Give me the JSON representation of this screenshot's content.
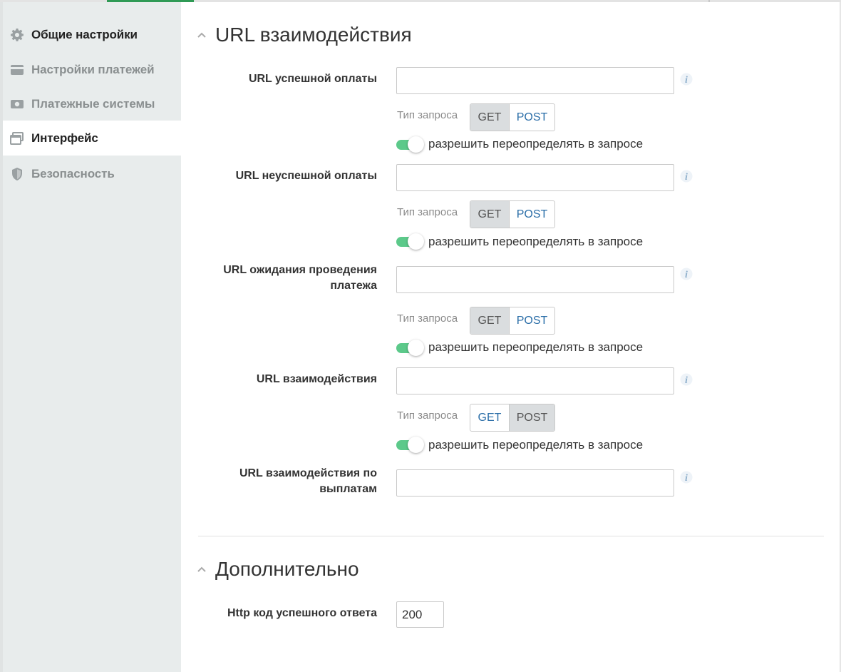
{
  "sidebar": {
    "items": [
      {
        "label": "Общие настройки",
        "icon": "gear-icon"
      },
      {
        "label": "Настройки платежей",
        "icon": "card-icon"
      },
      {
        "label": "Платежные системы",
        "icon": "money-icon"
      },
      {
        "label": "Интерфейс",
        "icon": "window-icon"
      },
      {
        "label": "Безопасность",
        "icon": "shield-icon"
      }
    ],
    "active_index": 3
  },
  "sections": {
    "urls_title": "URL взаимодействия",
    "extra_title": "Дополнительно"
  },
  "fields": {
    "success_url": {
      "label": "URL успешной оплаты",
      "value": "",
      "method": "GET"
    },
    "fail_url": {
      "label": "URL неуспешной оплаты",
      "value": "",
      "method": "GET"
    },
    "pending_url_line1": "URL ожидания проведения",
    "pending_url_line2": "платежа",
    "pending_url": {
      "value": "",
      "method": "GET"
    },
    "interaction_url": {
      "label": "URL взаимодействия",
      "value": "",
      "method": "POST"
    },
    "payout_url_line1": "URL взаимодействия по",
    "payout_url_line2": "выплатам",
    "payout_url": {
      "value": ""
    },
    "http_code": {
      "label": "Http код успешного ответа",
      "value": "200"
    }
  },
  "common": {
    "request_type_label": "Тип запроса",
    "get_label": "GET",
    "post_label": "POST",
    "override_label": "разрешить переопределять в запросе",
    "override_enabled": true
  },
  "colors": {
    "accent_green": "#2f9a55",
    "toggle_on": "#5cc98a",
    "link_blue": "#2b6ea8",
    "sidebar_bg": "#e8ecec"
  }
}
